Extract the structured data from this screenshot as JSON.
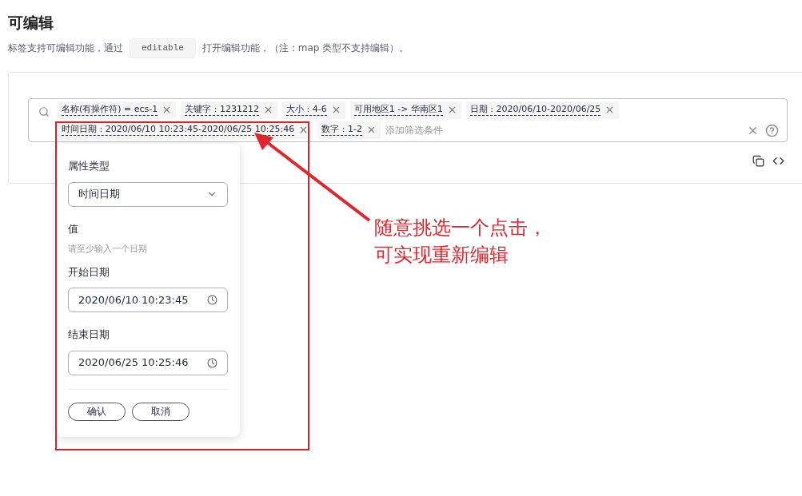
{
  "heading": "可编辑",
  "description": {
    "before": "标签支持可编辑功能，通过",
    "code": "editable",
    "after": "打开编辑功能，（注：map 类型不支持编辑）。"
  },
  "filter": {
    "tags": [
      {
        "label": "名称(有操作符) = ecs-1"
      },
      {
        "label": "关键字 : 1231212"
      },
      {
        "label": "大小 : 4-6"
      },
      {
        "label": "可用地区1 -> 华南区1"
      },
      {
        "label": "日期 : 2020/06/10-2020/06/25"
      },
      {
        "label": "时间日期 : 2020/06/10 10:23:45-2020/06/25 10:25:46"
      },
      {
        "label": "数字 : 1-2"
      }
    ],
    "placeholder": "添加筛选条件"
  },
  "popover": {
    "type_label": "属性类型",
    "type_value": "时间日期",
    "value_label": "值",
    "hint": "请至少输入一个日期",
    "start_label": "开始日期",
    "start_value": "2020/06/10 10:23:45",
    "end_label": "结束日期",
    "end_value": "2020/06/25 10:25:46",
    "buttons": [
      "确认",
      "取消"
    ]
  },
  "annotation": {
    "lines": [
      "随意挑选一个点击，",
      "可实现重新编辑"
    ]
  }
}
